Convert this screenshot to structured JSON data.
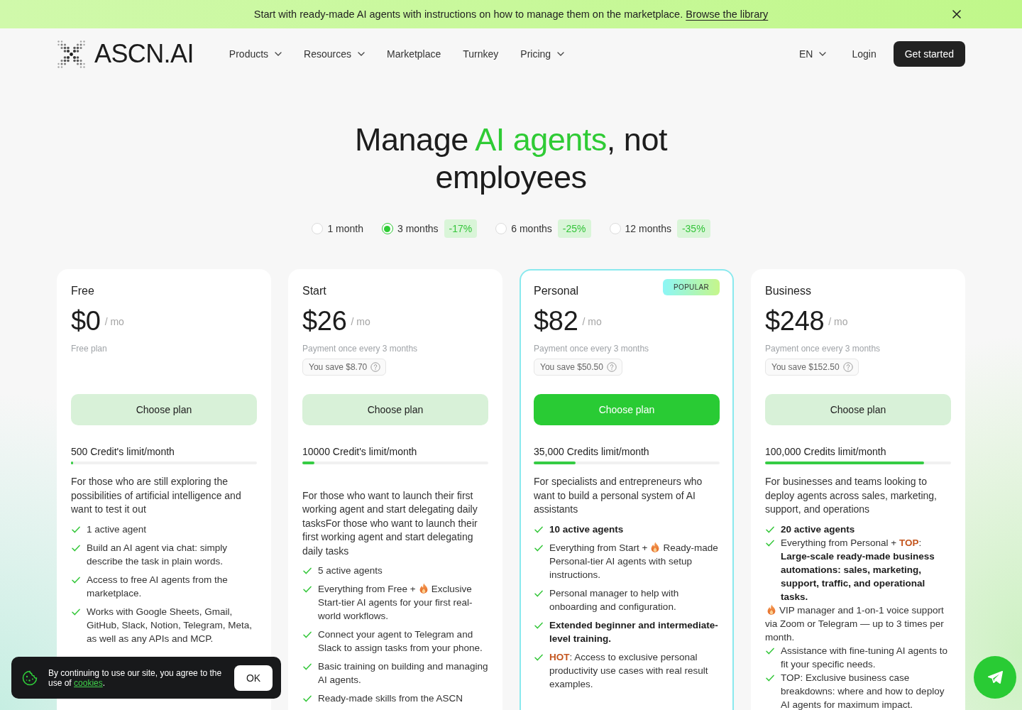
{
  "announcement": {
    "text": "Start with ready-made AI agents with instructions on how to manage them on the marketplace.",
    "link": "Browse the library"
  },
  "header": {
    "logo": "ASCN.AI",
    "nav": [
      {
        "label": "Products",
        "menu": true
      },
      {
        "label": "Resources",
        "menu": true
      },
      {
        "label": "Marketplace",
        "menu": false
      },
      {
        "label": "Turnkey",
        "menu": false
      },
      {
        "label": "Pricing",
        "menu": true
      }
    ],
    "language": "EN",
    "login": "Login",
    "cta": "Get started"
  },
  "hero": {
    "title_start": "Manage",
    "title_highlight": "AI agents",
    "title_end": ", not employees"
  },
  "periods": [
    {
      "label": "1 month",
      "selected": false
    },
    {
      "label": "3 months",
      "discount": "-17%",
      "selected": true
    },
    {
      "label": "6 months",
      "discount": "-25%",
      "selected": false
    },
    {
      "label": "12 months",
      "discount": "-35%",
      "selected": false
    }
  ],
  "plans": [
    {
      "name": "Free",
      "price": "$0",
      "unit": "/ mo",
      "note": "Free plan",
      "featured": false,
      "button": "Choose plan",
      "credits": {
        "label": "500 Credit's limit/month",
        "level": 0.01
      },
      "description": "For those who are still exploring the possibilities of artificial intelligence and want to test it out",
      "dense": false,
      "features": [
        {
          "kind": "check",
          "parts": [
            {
              "kind": "text",
              "text": "1 active agent"
            }
          ]
        },
        {
          "kind": "check",
          "parts": [
            {
              "kind": "text",
              "text": "Build an AI agent via chat: simply describe the task in plain words."
            }
          ]
        },
        {
          "kind": "check",
          "parts": [
            {
              "kind": "text",
              "text": "Access to free AI agents from the marketplace."
            }
          ]
        },
        {
          "kind": "check",
          "parts": [
            {
              "kind": "text",
              "text": "Works with Google Sheets, Gmail, GitHub, Slack, Notion, Telegram, Meta, as well as any APIs and MCP."
            }
          ]
        }
      ]
    },
    {
      "name": "Start",
      "price": "$26",
      "unit": "/ mo",
      "note": "Payment once every 3 months",
      "savings": "You save $8.70",
      "featured": false,
      "button": "Choose plan",
      "credits": {
        "label": "10000 Credit's limit/month",
        "level": 0.065
      },
      "description": "\nFor those who want to launch their first working agent and start delegating daily tasksFor those who want to launch their first working agent and start delegating daily tasks",
      "dense": false,
      "features": [
        {
          "kind": "check",
          "parts": [
            {
              "kind": "text",
              "text": "5 active agents"
            }
          ]
        },
        {
          "kind": "check",
          "parts": [
            {
              "kind": "text",
              "text": "Everything from Free +"
            },
            {
              "kind": "flame"
            },
            {
              "kind": "text",
              "text": "Exclusive Start-tier AI agents for your first real-world workflows."
            }
          ]
        },
        {
          "kind": "check",
          "parts": [
            {
              "kind": "text",
              "text": "Connect your agent to Telegram and Slack to assign tasks from your phone."
            }
          ]
        },
        {
          "kind": "check",
          "parts": [
            {
              "kind": "text",
              "text": "Basic training on building and managing AI agents."
            }
          ]
        },
        {
          "kind": "check",
          "parts": [
            {
              "kind": "text",
              "text": "Ready-made skills from the ASCN"
            }
          ]
        }
      ]
    },
    {
      "name": "Personal",
      "badge": "POPULAR",
      "price": "$82",
      "unit": "/ mo",
      "note": "Payment once every 3 months",
      "savings": "You save $50.50",
      "featured": true,
      "button": "Choose plan",
      "credits": {
        "label": "35,000 Credits limit/month",
        "level": 0.225
      },
      "description": "For specialists and entrepreneurs who want to build a personal system of AI assistants",
      "dense": false,
      "features": [
        {
          "kind": "check",
          "parts": [
            {
              "kind": "strong",
              "text": "10 active agents"
            }
          ]
        },
        {
          "kind": "check",
          "parts": [
            {
              "kind": "text",
              "text": "Everything from Start +"
            },
            {
              "kind": "flame"
            },
            {
              "kind": "text",
              "text": "Ready-made Personal-tier AI agents with setup instructions."
            }
          ]
        },
        {
          "kind": "check",
          "parts": [
            {
              "kind": "text",
              "text": "Personal manager to help with onboarding and configuration."
            }
          ]
        },
        {
          "kind": "check",
          "parts": [
            {
              "kind": "strong",
              "text": "Extended beginner and intermediate-level training."
            }
          ]
        },
        {
          "kind": "check",
          "parts": [
            {
              "kind": "accent",
              "text": "HOT"
            },
            {
              "kind": "text",
              "text": ": Access to exclusive personal productivity use cases with real result examples."
            }
          ]
        }
      ]
    },
    {
      "name": "Business",
      "price": "$248",
      "unit": "/ mo",
      "note": "Payment once every 3 months",
      "savings": "You save $152.50",
      "featured": false,
      "button": "Choose plan",
      "credits": {
        "label": "100,000 Credits limit/month",
        "level": 0.855
      },
      "description": "For businesses and teams looking to deploy agents across sales, marketing, support, and operations",
      "dense": true,
      "features": [
        {
          "kind": "check",
          "parts": [
            {
              "kind": "strong",
              "text": "20 active agents"
            }
          ]
        },
        {
          "kind": "check",
          "parts": [
            {
              "kind": "text",
              "text": "Everything from Personal +"
            },
            {
              "kind": "accent",
              "text": "TOP"
            },
            {
              "kind": "text",
              "text": ": "
            },
            {
              "kind": "strong",
              "text": "Large-scale ready-made business automations: sales, marketing, support, traffic, and operational tasks."
            }
          ]
        },
        {
          "kind": "plain",
          "parts": [
            {
              "kind": "flame"
            },
            {
              "kind": "text",
              "text": "VIP manager and 1-on-1 voice support via Zoom or Telegram — up to 3 times per month."
            }
          ]
        },
        {
          "kind": "check",
          "parts": [
            {
              "kind": "text",
              "text": "Assistance with fine-tuning AI agents to fit your specific needs."
            }
          ]
        },
        {
          "kind": "check",
          "parts": [
            {
              "kind": "text",
              "text": "TOP: Exclusive business case breakdowns: where and how to deploy AI agents for maximum impact."
            }
          ]
        }
      ]
    }
  ],
  "cookie_notice": {
    "text": "By continuing to use our site, you agree to the use of",
    "link": "cookies",
    "end": ".",
    "button": "OK"
  }
}
